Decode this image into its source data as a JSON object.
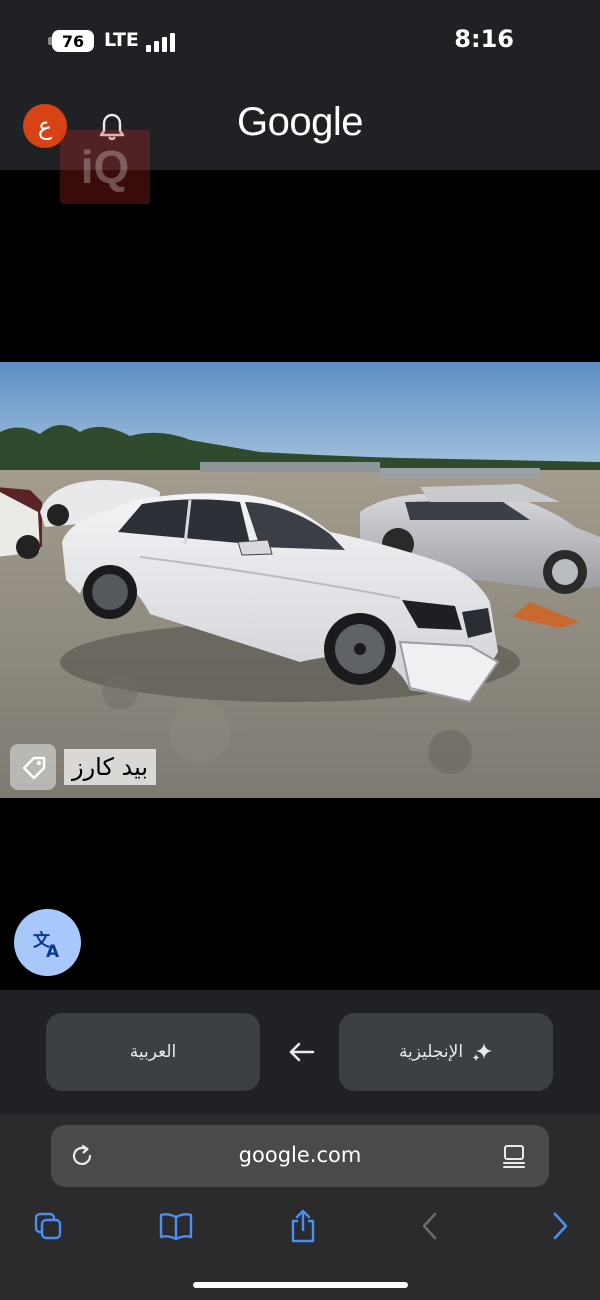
{
  "status_bar": {
    "battery": "76",
    "network": "LTE",
    "time": "8:16"
  },
  "header": {
    "avatar_letter": "ع",
    "logo": "Google",
    "watermark": "iQ"
  },
  "image_label": {
    "text": "بيد     كارز",
    "icon": "tag-icon"
  },
  "translation": {
    "source_language": "العربية",
    "target_language": "الإنجليزية",
    "target_icon": "sparkle-icon",
    "swap_icon": "arrow-left-icon",
    "fab_icon": "translate-icon"
  },
  "browser": {
    "url": "google.com",
    "reload_icon": "reload-icon",
    "reader_icon": "reader-icon"
  },
  "toolbar": {
    "items": [
      "tabs-icon",
      "bookmarks-icon",
      "share-icon",
      "back-icon",
      "forward-icon"
    ]
  },
  "colors": {
    "accent": "#4a8ff5",
    "fab": "#a8c7fa",
    "avatar": "#d84315",
    "header_bg": "#202124"
  }
}
